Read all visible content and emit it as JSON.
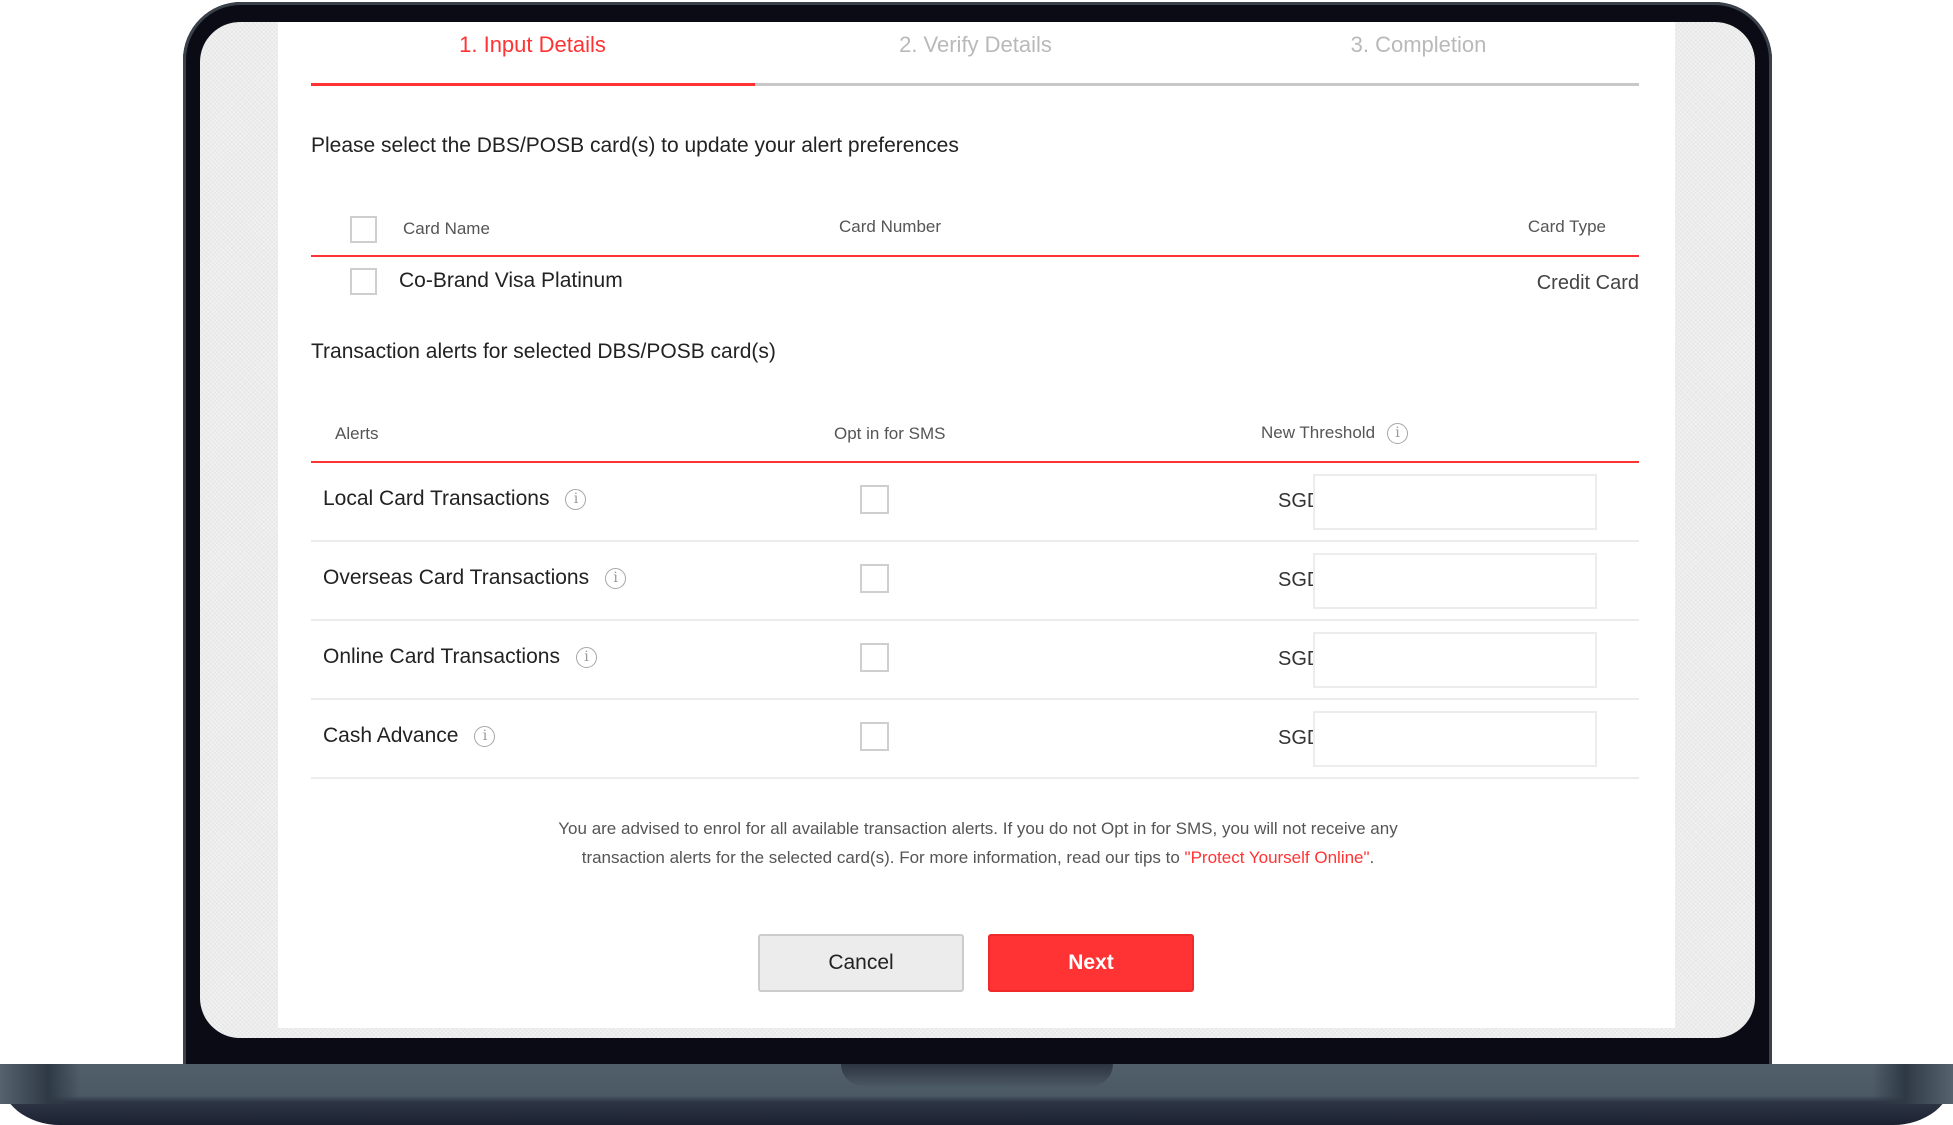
{
  "steps": [
    {
      "label": "1. Input Details",
      "active": true
    },
    {
      "label": "2. Verify Details",
      "active": false
    },
    {
      "label": "3. Completion",
      "active": false
    }
  ],
  "card_section": {
    "heading": "Please select the DBS/POSB card(s) to update your alert preferences",
    "columns": {
      "name": "Card Name",
      "number": "Card Number",
      "type": "Card Type"
    },
    "select_all_checked": false,
    "rows": [
      {
        "name": "Co-Brand Visa Platinum",
        "number": "",
        "type": "Credit Card",
        "checked": false
      }
    ]
  },
  "alerts_section": {
    "heading": "Transaction alerts for selected DBS/POSB card(s)",
    "columns": {
      "alerts": "Alerts",
      "sms": "Opt in for SMS",
      "threshold": "New Threshold"
    },
    "threshold_info_icon": "info-icon",
    "rows": [
      {
        "label": "Local Card Transactions",
        "info_icon": "info-icon",
        "sms_checked": false,
        "currency": "SGD",
        "threshold": ""
      },
      {
        "label": "Overseas Card Transactions",
        "info_icon": "info-icon",
        "sms_checked": false,
        "currency": "SGD",
        "threshold": ""
      },
      {
        "label": "Online Card Transactions",
        "info_icon": "info-icon",
        "sms_checked": false,
        "currency": "SGD",
        "threshold": ""
      },
      {
        "label": "Cash Advance",
        "info_icon": "info-icon",
        "sms_checked": false,
        "currency": "SGD",
        "threshold": ""
      }
    ]
  },
  "notice": {
    "text_before_link": "You are advised to enrol for all available transaction alerts. If you do not Opt in for SMS, you will not receive any transaction alerts for the selected card(s). For more information, read our tips to ",
    "link_text": "\"Protect Yourself Online\"",
    "text_after_link": "."
  },
  "buttons": {
    "cancel": "Cancel",
    "next": "Next"
  },
  "colors": {
    "accent": "#ff3333",
    "inactive_step": "#b9b9b9",
    "divider": "#ececec",
    "laptop_bezel": "#0a0b14",
    "laptop_base": "#4b5965"
  }
}
